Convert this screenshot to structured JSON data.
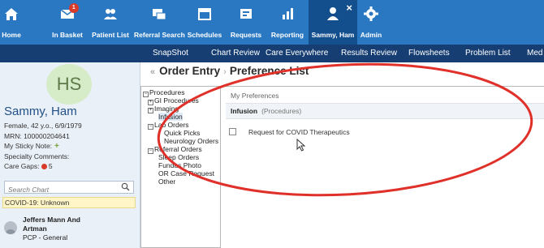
{
  "toolbar": {
    "items": [
      {
        "label": "Home",
        "icon": "home-icon"
      },
      {
        "label": "In Basket",
        "icon": "envelope-icon",
        "badge": "1"
      },
      {
        "label": "Patient List",
        "icon": "people-icon"
      },
      {
        "label": "Referral Search",
        "icon": "referral-icon"
      },
      {
        "label": "Schedules",
        "icon": "calendar-icon"
      },
      {
        "label": "Requests",
        "icon": "requests-icon"
      },
      {
        "label": "Reporting",
        "icon": "chart-icon"
      },
      {
        "label": "Sammy, Ham",
        "icon": "person-icon",
        "active": true
      },
      {
        "label": "Admin",
        "icon": "gear-icon"
      }
    ],
    "close_glyph": "×",
    "bg_color": "#2a78c2"
  },
  "tabs": [
    "SnapShot",
    "Chart Review",
    "Care Everywhere",
    "Results Review",
    "Flowsheets",
    "Problem List",
    "Med"
  ],
  "patient": {
    "initials": "HS",
    "name": "Sammy, Ham",
    "demographics": "Female, 42 y.o., 6/9/1979",
    "mrn": "MRN: 100000204641",
    "sticky_note": "My Sticky Note:",
    "specialty_comments": "Specialty Comments:",
    "care_gaps_label": "Care Gaps:",
    "care_gaps_count": "5",
    "search_placeholder": "Search Chart",
    "covid": "COVID-19: Unknown",
    "pcp_name_1": "Jeffers Mann And",
    "pcp_name_2": "Artman",
    "pcp_role": "PCP - General"
  },
  "breadcrumb": {
    "back_glyph": "«",
    "first": "Order Entry",
    "separator": "›",
    "current": "Preference List"
  },
  "tree": {
    "procedures": "Procedures",
    "gi": "GI Procedures",
    "imaging": "Imaging",
    "infusion": "Infusion",
    "lab_orders": "Lab Orders",
    "quick_picks": "Quick Picks",
    "neurology": "Neurology Orders",
    "referral": "Referral Orders",
    "sleep": "Sleep Orders",
    "fundus": "Fundus Photo",
    "or_case": "OR Case Request",
    "other": "Other"
  },
  "preferences": {
    "header": "My Preferences",
    "section_name": "Infusion",
    "section_category": "(Procedures)",
    "rows": [
      {
        "label": "Request for COVID Therapeutics",
        "checked": false
      }
    ]
  },
  "colors": {
    "toolbar": "#2a78c2",
    "tabs_bar": "#163e73",
    "annotation": "#e0302a"
  }
}
